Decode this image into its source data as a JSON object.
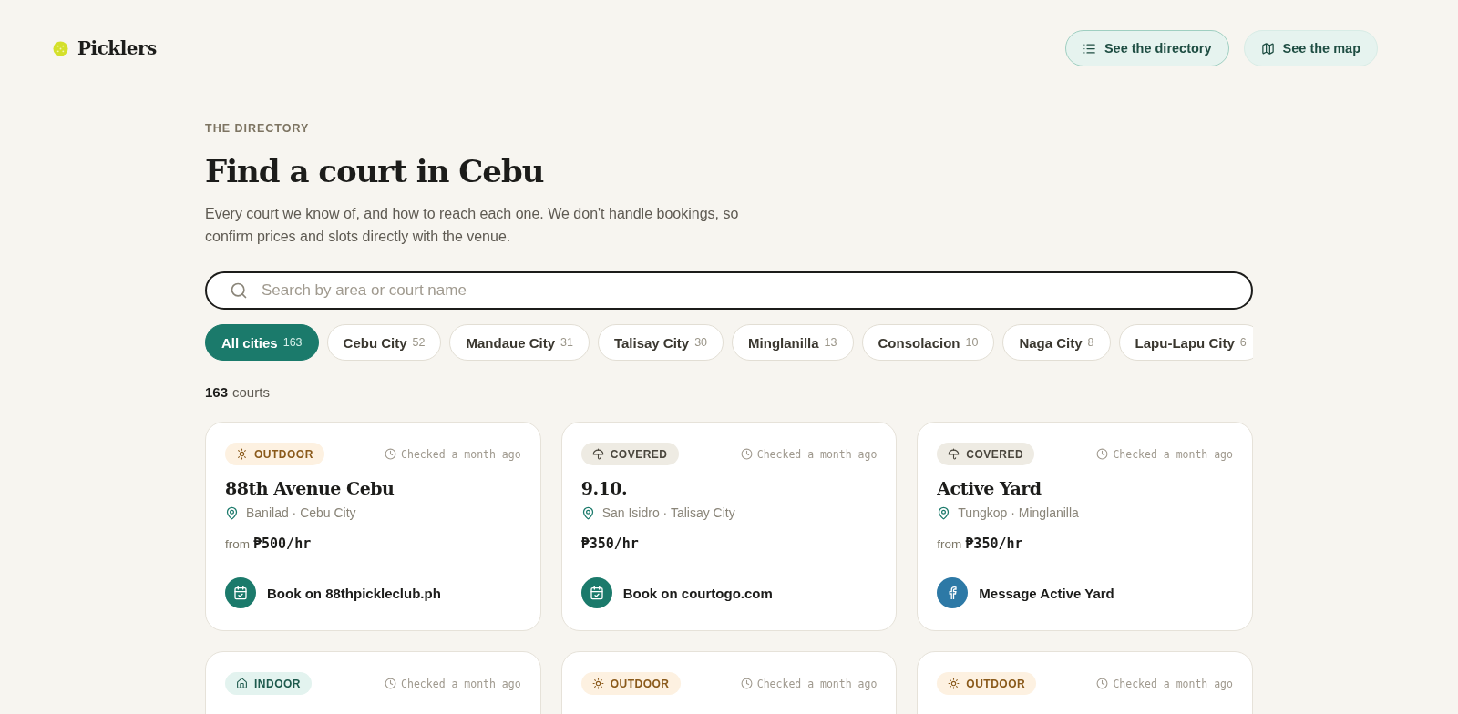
{
  "brand": {
    "name": "Picklers"
  },
  "nav": [
    {
      "label": "See the directory",
      "kind": "list",
      "selected": true
    },
    {
      "label": "See the map",
      "kind": "map",
      "selected": false
    }
  ],
  "eyebrow": "THE DIRECTORY",
  "title": "Find a court in Cebu",
  "intro": "Every court we know of, and how to reach each one. We don't handle bookings, so confirm prices and slots directly with the venue.",
  "search": {
    "placeholder": "Search by area or court name"
  },
  "filters": [
    {
      "label": "All cities",
      "count": "163",
      "selected": true
    },
    {
      "label": "Cebu City",
      "count": "52",
      "selected": false
    },
    {
      "label": "Mandaue City",
      "count": "31",
      "selected": false
    },
    {
      "label": "Talisay City",
      "count": "30",
      "selected": false
    },
    {
      "label": "Minglanilla",
      "count": "13",
      "selected": false
    },
    {
      "label": "Consolacion",
      "count": "10",
      "selected": false
    },
    {
      "label": "Naga City",
      "count": "8",
      "selected": false
    },
    {
      "label": "Lapu-Lapu City",
      "count": "6",
      "selected": false
    }
  ],
  "result_count": {
    "number": "163",
    "label": "courts"
  },
  "courts": [
    {
      "type": {
        "kind": "outdoor",
        "label": "OUTDOOR"
      },
      "checked": "Checked a month ago",
      "name": "88th Avenue Cebu",
      "location": "Banilad · Cebu City",
      "price_prefix": "from",
      "price": "₱500/hr",
      "action": {
        "kind": "booking",
        "label": "Book on 88thpickleclub.ph"
      }
    },
    {
      "type": {
        "kind": "covered",
        "label": "COVERED"
      },
      "checked": "Checked a month ago",
      "name": "9.10.",
      "location": "San Isidro · Talisay City",
      "price": "₱350/hr",
      "action": {
        "kind": "booking",
        "label": "Book on courtogo.com"
      }
    },
    {
      "type": {
        "kind": "covered",
        "label": "COVERED"
      },
      "checked": "Checked a month ago",
      "name": "Active Yard",
      "location": "Tungkop · Minglanilla",
      "price_prefix": "from",
      "price": "₱350/hr",
      "action": {
        "kind": "facebook",
        "label": "Message Active Yard"
      }
    },
    {
      "type": {
        "kind": "indoor",
        "label": "INDOOR"
      },
      "checked": "Checked a month ago"
    },
    {
      "type": {
        "kind": "outdoor",
        "label": "OUTDOOR"
      },
      "checked": "Checked a month ago"
    },
    {
      "type": {
        "kind": "outdoor",
        "label": "OUTDOOR"
      },
      "checked": "Checked a month ago"
    }
  ]
}
